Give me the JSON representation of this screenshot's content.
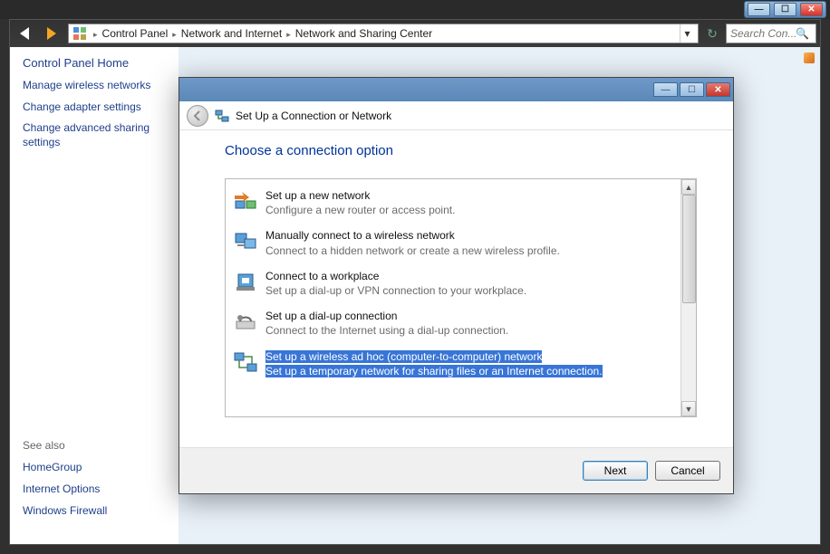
{
  "taskbar": {
    "minimize": "—",
    "maximize": "☐",
    "close": "✕"
  },
  "breadcrumbs": {
    "root": "Control Panel",
    "l2": "Network and Internet",
    "l3": "Network and Sharing Center"
  },
  "search": {
    "placeholder": "Search Con..."
  },
  "sidebar": {
    "home": "Control Panel Home",
    "links": [
      "Manage wireless networks",
      "Change adapter settings",
      "Change advanced sharing settings"
    ],
    "see_also_label": "See also",
    "see_also": [
      "HomeGroup",
      "Internet Options",
      "Windows Firewall"
    ]
  },
  "dialog": {
    "tb": {
      "min": "—",
      "max": "☐",
      "close": "✕"
    },
    "header_title": "Set Up a Connection or Network",
    "heading": "Choose a connection option",
    "options": [
      {
        "title": "Set up a new network",
        "desc": "Configure a new router or access point."
      },
      {
        "title": "Manually connect to a wireless network",
        "desc": "Connect to a hidden network or create a new wireless profile."
      },
      {
        "title": "Connect to a workplace",
        "desc": "Set up a dial-up or VPN connection to your workplace."
      },
      {
        "title": "Set up a dial-up connection",
        "desc": "Connect to the Internet using a dial-up connection."
      },
      {
        "title": "Set up a wireless ad hoc (computer-to-computer) network",
        "desc": "Set up a temporary network for sharing files or an Internet connection."
      }
    ],
    "selected_index": 4,
    "next": "Next",
    "cancel": "Cancel"
  }
}
